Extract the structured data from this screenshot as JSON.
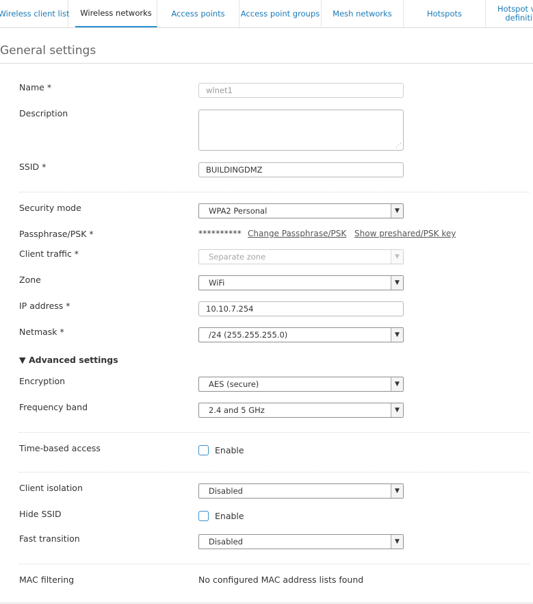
{
  "tabs": [
    {
      "label": "Wireless client list"
    },
    {
      "label": "Wireless networks",
      "active": true
    },
    {
      "label": "Access points"
    },
    {
      "label": "Access point groups"
    },
    {
      "label": "Mesh networks"
    },
    {
      "label": "Hotspots"
    },
    {
      "label": "Hotspot vo\ndefiniti"
    }
  ],
  "section": {
    "title": "General settings"
  },
  "fields": {
    "name": {
      "label": "Name *",
      "value": "wlnet1"
    },
    "description": {
      "label": "Description",
      "value": ""
    },
    "ssid": {
      "label": "SSID *",
      "value": "BUILDINGDMZ"
    },
    "security_mode": {
      "label": "Security mode",
      "value": "WPA2 Personal"
    },
    "passphrase": {
      "label": "Passphrase/PSK *",
      "masked": "**********",
      "change_link": "Change Passphrase/PSK",
      "show_link": "Show preshared/PSK key"
    },
    "client_traffic": {
      "label": "Client traffic *",
      "value": "Separate zone"
    },
    "zone": {
      "label": "Zone",
      "value": "WiFi"
    },
    "ip_address": {
      "label": "IP address *",
      "value": "10.10.7.254"
    },
    "netmask": {
      "label": "Netmask *",
      "value": "/24 (255.255.255.0)"
    }
  },
  "advanced": {
    "toggle_label": "▼ Advanced settings",
    "encryption": {
      "label": "Encryption",
      "value": "AES (secure)"
    },
    "frequency_band": {
      "label": "Frequency band",
      "value": "2.4 and 5 GHz"
    },
    "time_based_access": {
      "label": "Time-based access",
      "checkbox_label": "Enable",
      "checked": false
    },
    "client_isolation": {
      "label": "Client isolation",
      "value": "Disabled"
    },
    "hide_ssid": {
      "label": "Hide SSID",
      "checkbox_label": "Enable",
      "checked": false
    },
    "fast_transition": {
      "label": "Fast transition",
      "value": "Disabled"
    },
    "mac_filtering": {
      "label": "MAC filtering",
      "value": "No configured MAC address lists found"
    }
  },
  "colors": {
    "link": "#1a7ab8",
    "active_tab_underline": "#2a8fd0",
    "checkbox_border": "#3a8fc8"
  },
  "icons": {
    "select_caret": "chevron-down-icon",
    "resize_grip": "resize-grip-icon"
  }
}
